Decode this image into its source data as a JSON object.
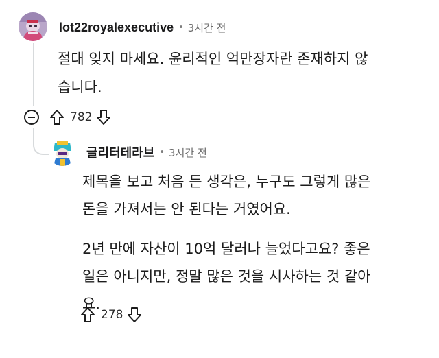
{
  "comments": [
    {
      "username": "lot22royalexecutive",
      "separator": "•",
      "time": "3시간 전",
      "body_lines": [
        "절대 잊지 마세요. 윤리적인 억만장자란 존재하지 않",
        "습니다."
      ],
      "votes": "782"
    },
    {
      "username": "글리터테라브",
      "separator": "•",
      "time": "3시간 전",
      "paragraphs": [
        {
          "lines": [
            "제목을 보고 처음 든 생각은, 누구도 그렇게 많은",
            "돈을 가져서는 안 된다는 거였어요."
          ]
        },
        {
          "lines": [
            "2년 만에 자산이 10억 달러나 늘었다고요? 좋은",
            "일은 아니지만, 정말 많은 것을 시사하는 것 같아",
            "요."
          ]
        }
      ],
      "votes": "278"
    }
  ],
  "icons": {
    "collapse": "minus-circle-icon",
    "upvote": "arrow-up-icon",
    "downvote": "arrow-down-icon"
  },
  "colors": {
    "thread_line": "#d7dadc",
    "meta_text": "#6b6b6b",
    "body_text": "#1c1c1c"
  }
}
